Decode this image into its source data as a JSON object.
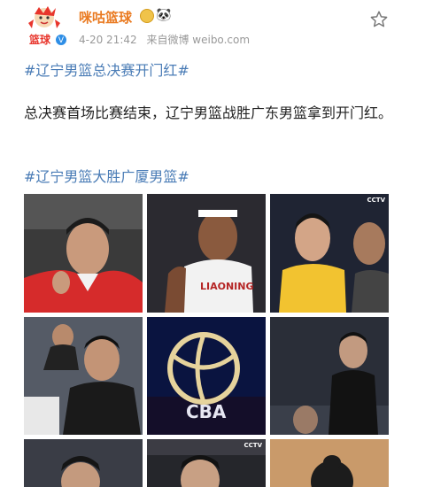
{
  "post": {
    "author": {
      "name": "咪咕篮球",
      "avatar_text": "篮球",
      "badges": [
        "medal-icon",
        "panda-icon"
      ]
    },
    "meta": {
      "date": "4-20 21:42",
      "source": "来自微博 weibo.com"
    },
    "hashtags": [
      "#辽宁男篮总决赛开门红#",
      "#辽宁男篮大胜广厦男篮#"
    ],
    "text": "总决赛首场比赛结束，辽宁男篮战胜广东男篮拿到开门红。",
    "images": [
      {
        "name": "player-redshirt-photo",
        "caption": ""
      },
      {
        "name": "liaoning-player-white-jersey-photo",
        "caption": "LIAONING"
      },
      {
        "name": "yellow-jersey-player-photo",
        "caption": "CCTV"
      },
      {
        "name": "coach-celebrating-photo",
        "caption": ""
      },
      {
        "name": "cba-logo-image",
        "caption": "CBA"
      },
      {
        "name": "coach-black-suit-photo",
        "caption": ""
      },
      {
        "name": "player-closeup-photo",
        "caption": ""
      },
      {
        "name": "player-portrait-photo",
        "caption": "CCTV"
      },
      {
        "name": "player-back-view-photo",
        "caption": ""
      }
    ],
    "colors": {
      "username": "#ea7b22",
      "hashtag": "#4a7cb6",
      "meta": "#999999"
    }
  }
}
